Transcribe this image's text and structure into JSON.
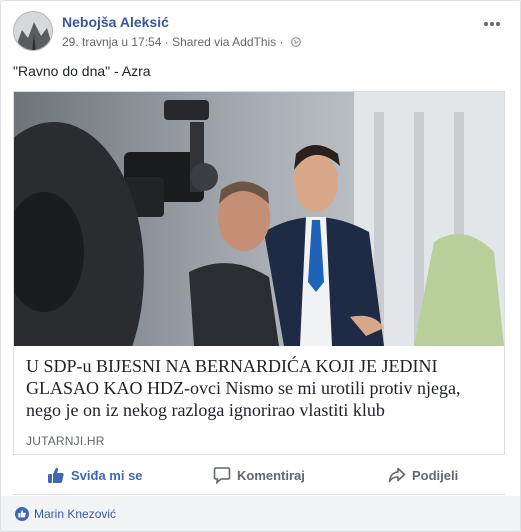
{
  "post": {
    "author": "Nebojša Aleksić",
    "timestamp": "29. travnja u 17:54",
    "shared_via": "Shared via AddThis",
    "separator": "·",
    "privacy_icon": "globe-icon",
    "more_icon": "more-options-icon",
    "text": "\"Ravno do dna\" - Azra"
  },
  "link": {
    "title": "U SDP-u BIJESNI NA BERNARDIĆA KOJI JE JEDINI GLASAO KAO HDZ-ovci Nismo se mi urotili protiv njega, nego je on iz nekog razloga ignorirao vlastiti klub",
    "domain": "JUTARNJI.HR"
  },
  "actions": {
    "like_label": "Sviđa mi se",
    "comment_label": "Komentiraj",
    "share_label": "Podijeli"
  },
  "reactions": {
    "names": "Marin Knezović"
  },
  "colors": {
    "link_blue": "#365899",
    "like_blue": "#4267b2",
    "muted_text": "#606770"
  }
}
